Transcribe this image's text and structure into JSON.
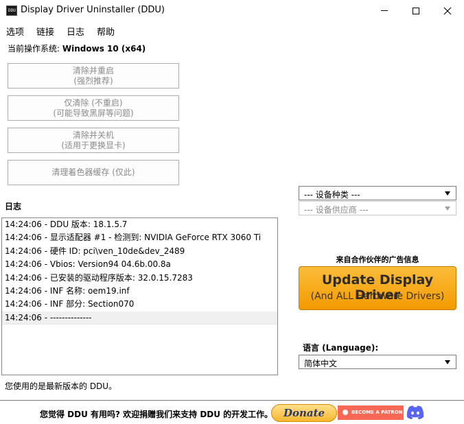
{
  "window": {
    "title": "Display Driver Uninstaller (DDU)",
    "icon_text": "DDU"
  },
  "menu": {
    "items": [
      {
        "label": "选项"
      },
      {
        "label": "链接"
      },
      {
        "label": "日志"
      },
      {
        "label": "帮助"
      }
    ]
  },
  "os": {
    "prefix": "当前操作系统:",
    "value": "Windows 10 (x64)"
  },
  "actions": [
    {
      "line1": "清除并重启",
      "line2": "(强烈推荐)"
    },
    {
      "line1": "仅清除 (不重启)",
      "line2": "(可能导致黑屏等问题)"
    },
    {
      "line1": "清除并关机",
      "line2": "(适用于更换显卡)"
    },
    {
      "line1": "清理着色器缓存 (仅此)",
      "line2": ""
    }
  ],
  "log": {
    "label": "日志",
    "lines": [
      "14:24:06 - DDU 版本: 18.1.5.7",
      "14:24:06 - 显示适配器 #1 - 检测到: NVIDIA GeForce RTX 3060 Ti",
      "14:24:06 - 硬件 ID: pci\\ven_10de&dev_2489",
      "14:24:06 - Vbios: Version94 04.6b.00.8a",
      "14:24:06 - 已安装的驱动程序版本: 32.0.15.7283",
      "14:24:06 - INF 名称: oem19.inf",
      "14:24:06 - INF 部分: Section070",
      "14:24:06 - --------------"
    ]
  },
  "status": "您使用的是最新版本的 DDU。",
  "device_type": {
    "value": "--- 设备种类 ---"
  },
  "device_vendor": {
    "value": "--- 设备供应商 ---"
  },
  "ad": {
    "label": "来自合作伙伴的广告信息",
    "title": "Update Display Driver",
    "subtitle": "(And ALL Hardware Drivers)"
  },
  "language": {
    "label": "语言 (Language):",
    "value": "简体中文"
  },
  "footer": {
    "text": "您觉得 DDU 有用吗? 欢迎捐赠我们来支持 DDU 的开发工作。",
    "donate": "Donate",
    "patron": "BECOME A PATRON"
  },
  "colors": {
    "ad_orange": "#f39a00",
    "patreon": "#f96854",
    "discord": "#5865f2"
  }
}
